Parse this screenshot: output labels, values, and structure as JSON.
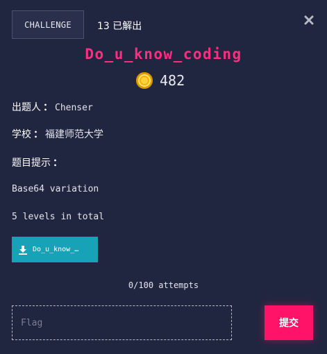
{
  "challenge": {
    "category": "CHALLENGE",
    "solves": "13 已解出",
    "title": "Do_u_know_coding",
    "points": "482"
  },
  "info": {
    "author_label": "出题人",
    "author": "Chenser",
    "school_label": "学校",
    "school": "福建师范大学",
    "hint_label": "题目提示",
    "separator": "："
  },
  "description": {
    "line1": "Base64 variation",
    "line2": "5 levels in total"
  },
  "file": {
    "name": "Do_u_know_…",
    "icon": "download-icon"
  },
  "attempts": "0/100 attempts",
  "flag": {
    "placeholder": "Flag",
    "value": ""
  },
  "submit_label": "提交",
  "colors": {
    "background": "#212640",
    "title": "#ff2e80",
    "file_button": "#17a2b8",
    "submit_button": "#ff1368",
    "coin": "#f5b400"
  }
}
